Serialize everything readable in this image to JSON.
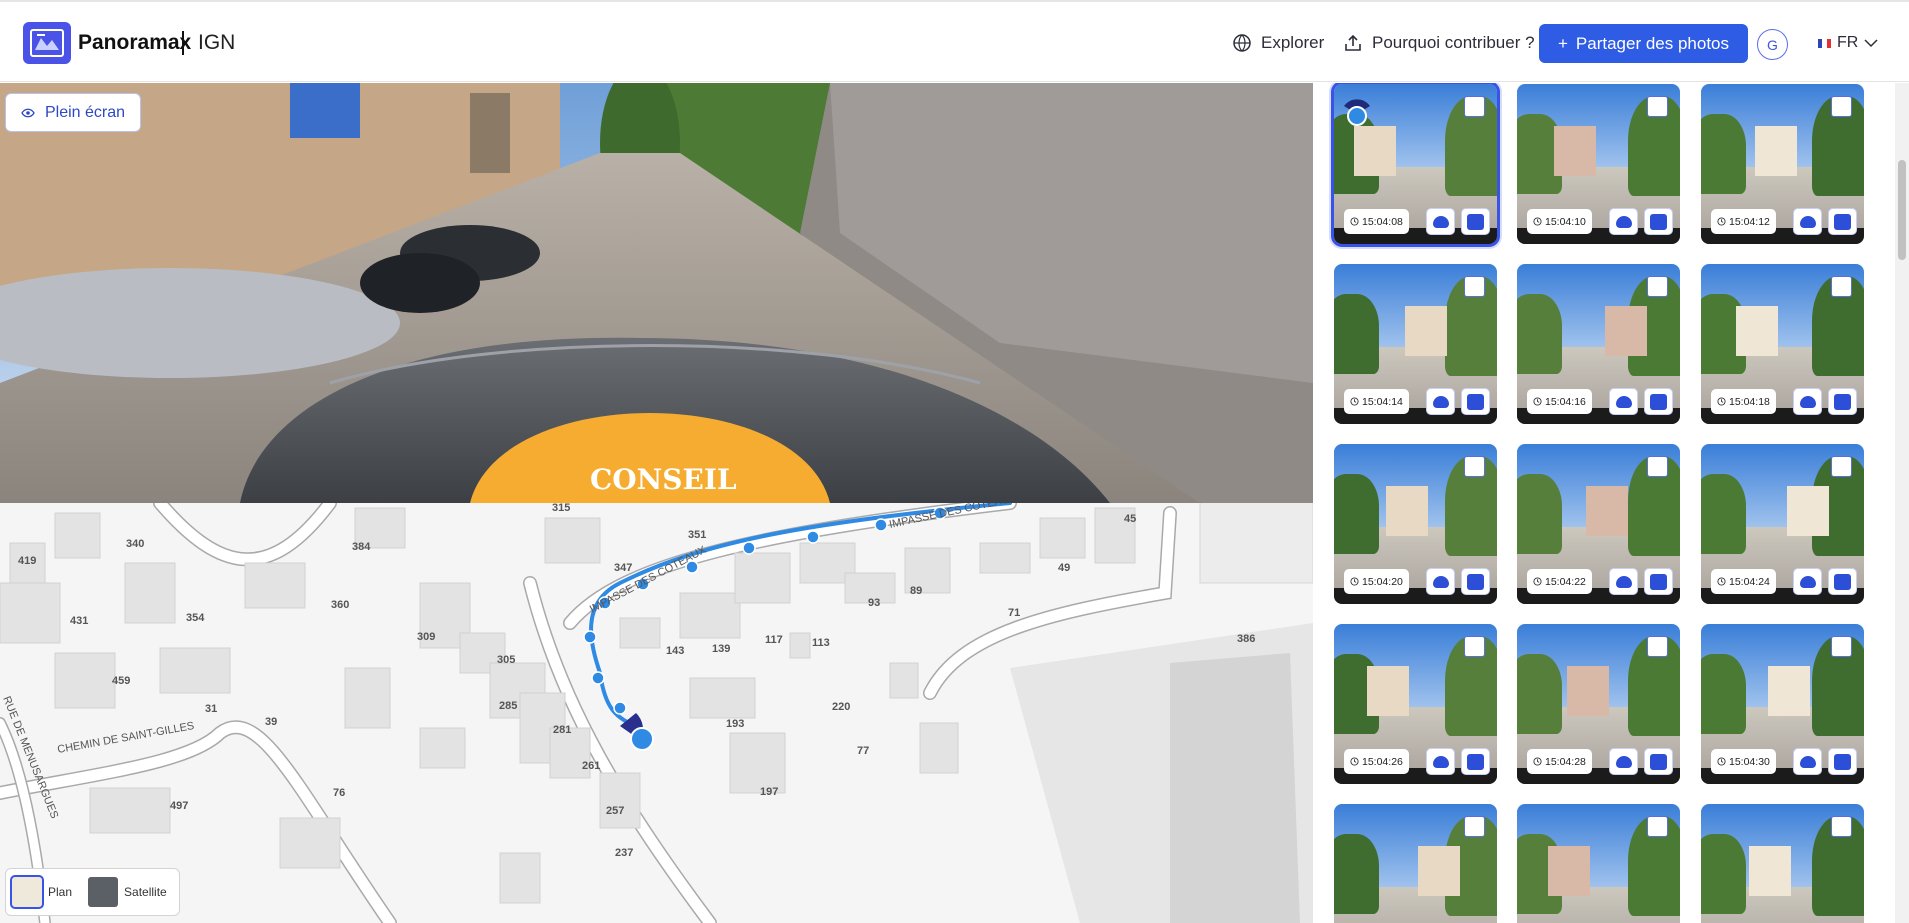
{
  "app": {
    "name": "Panoramax",
    "instance": "IGN"
  },
  "nav": {
    "explorer": "Explorer",
    "why": "Pourquoi contribuer ?",
    "share": "Partager des photos",
    "avatar_letter": "G",
    "language": "FR"
  },
  "viewer": {
    "fullscreen_label": "Plein écran",
    "sign_text": "CONSEIL"
  },
  "map": {
    "labels": [
      "315",
      "340",
      "384",
      "351",
      "347",
      "419",
      "360",
      "431",
      "354",
      "459",
      "309",
      "305",
      "285",
      "281",
      "261",
      "257",
      "237",
      "143",
      "139",
      "117",
      "113",
      "93",
      "89",
      "71",
      "49",
      "45",
      "193",
      "220",
      "77",
      "197",
      "386",
      "497",
      "76",
      "31",
      "39"
    ],
    "streets": [
      "IMPASSE DES COTEAUX",
      "CHEMIN DE SAINT-GILLES",
      "RUE DE MENUSARGUES",
      "IMPASSE DES COTEAUX"
    ],
    "layer_plan": "Plan",
    "layer_satellite": "Satellite"
  },
  "gallery": {
    "photos": [
      {
        "time": "15:04:08"
      },
      {
        "time": "15:04:10"
      },
      {
        "time": "15:04:12"
      },
      {
        "time": "15:04:14"
      },
      {
        "time": "15:04:16"
      },
      {
        "time": "15:04:18"
      },
      {
        "time": "15:04:20"
      },
      {
        "time": "15:04:22"
      },
      {
        "time": "15:04:24"
      },
      {
        "time": "15:04:26"
      },
      {
        "time": "15:04:28"
      },
      {
        "time": "15:04:30"
      },
      {
        "time": ""
      },
      {
        "time": ""
      },
      {
        "time": ""
      }
    ]
  },
  "colors": {
    "accent": "#2e5ce5",
    "route": "#2f8ae4",
    "sign": "#f5ac31"
  }
}
